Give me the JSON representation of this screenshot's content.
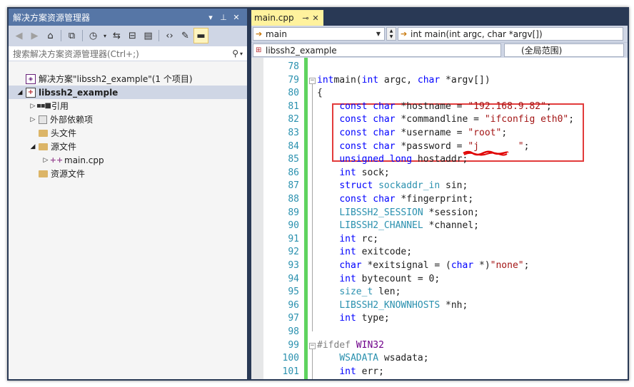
{
  "solution_explorer": {
    "title": "解决方案资源管理器",
    "title_buttons": [
      "▾",
      "⊥",
      "✕"
    ],
    "search_placeholder": "搜索解决方案资源管理器(Ctrl+;)",
    "tree": [
      {
        "label": "解决方案\"libssh2_example\"(1 个项目)",
        "level": 0,
        "icon": "solution-icon",
        "expand": ""
      },
      {
        "label": "libssh2_example",
        "level": 0,
        "icon": "cpp-project-icon",
        "expand": "◢",
        "selected": true
      },
      {
        "label": "引用",
        "level": 1,
        "icon": "references-icon",
        "expand": "▷"
      },
      {
        "label": "外部依赖项",
        "level": 1,
        "icon": "external-dependencies-icon",
        "expand": "▷"
      },
      {
        "label": "头文件",
        "level": 1,
        "icon": "folder-icon",
        "expand": ""
      },
      {
        "label": "源文件",
        "level": 1,
        "icon": "folder-open-icon",
        "expand": "◢"
      },
      {
        "label": "main.cpp",
        "level": 2,
        "icon": "cpp-file-icon",
        "expand": "▷"
      },
      {
        "label": "资源文件",
        "level": 1,
        "icon": "folder-icon",
        "expand": ""
      }
    ]
  },
  "editor": {
    "tab": {
      "label": "main.cpp"
    },
    "nav": {
      "scope": "main",
      "member": "int main(int argc, char *argv[])",
      "project": "libssh2_example",
      "range": "(全局范围)"
    },
    "first_line": 78,
    "line_numbers": [
      "78",
      "79",
      "80",
      "81",
      "82",
      "83",
      "84",
      "85",
      "86",
      "87",
      "88",
      "89",
      "90",
      "91",
      "92",
      "93",
      "94",
      "95",
      "96",
      "97",
      "98",
      "99",
      "100",
      "101"
    ],
    "lines": [
      [],
      [
        [
          "kw",
          "int"
        ],
        [
          "",
          "main("
        ],
        [
          "kw",
          "int"
        ],
        [
          "",
          " argc, "
        ],
        [
          "kw",
          "char"
        ],
        [
          "",
          " *argv[])"
        ]
      ],
      [
        [
          "",
          "{"
        ]
      ],
      [
        [
          "",
          "    "
        ],
        [
          "kw",
          "const"
        ],
        [
          "",
          " "
        ],
        [
          "kw",
          "char"
        ],
        [
          "",
          " *hostname = "
        ],
        [
          "st",
          "\"192.168.9.82\""
        ],
        [
          "",
          ";"
        ]
      ],
      [
        [
          "",
          "    "
        ],
        [
          "kw",
          "const"
        ],
        [
          "",
          " "
        ],
        [
          "kw",
          "char"
        ],
        [
          "",
          " *commandline = "
        ],
        [
          "st",
          "\"ifconfig eth0\""
        ],
        [
          "",
          ";"
        ]
      ],
      [
        [
          "",
          "    "
        ],
        [
          "kw",
          "const"
        ],
        [
          "",
          " "
        ],
        [
          "kw",
          "char"
        ],
        [
          "",
          " *username = "
        ],
        [
          "st",
          "\"root\""
        ],
        [
          "",
          ";"
        ]
      ],
      [
        [
          "",
          "    "
        ],
        [
          "kw",
          "const"
        ],
        [
          "",
          " "
        ],
        [
          "kw",
          "char"
        ],
        [
          "",
          " *password = "
        ],
        [
          "st",
          "\"j       \""
        ],
        [
          "",
          ";"
        ]
      ],
      [
        [
          "",
          "    "
        ],
        [
          "kw",
          "unsigned"
        ],
        [
          "",
          " "
        ],
        [
          "kw",
          "long"
        ],
        [
          "",
          " hostaddr;"
        ]
      ],
      [
        [
          "",
          "    "
        ],
        [
          "kw",
          "int"
        ],
        [
          "",
          " sock;"
        ]
      ],
      [
        [
          "",
          "    "
        ],
        [
          "kw",
          "struct"
        ],
        [
          "",
          " "
        ],
        [
          "ty",
          "sockaddr_in"
        ],
        [
          "",
          " sin;"
        ]
      ],
      [
        [
          "",
          "    "
        ],
        [
          "kw",
          "const"
        ],
        [
          "",
          " "
        ],
        [
          "kw",
          "char"
        ],
        [
          "",
          " *fingerprint;"
        ]
      ],
      [
        [
          "",
          "    "
        ],
        [
          "ty",
          "LIBSSH2_SESSION"
        ],
        [
          "",
          " *session;"
        ]
      ],
      [
        [
          "",
          "    "
        ],
        [
          "ty",
          "LIBSSH2_CHANNEL"
        ],
        [
          "",
          " *channel;"
        ]
      ],
      [
        [
          "",
          "    "
        ],
        [
          "kw",
          "int"
        ],
        [
          "",
          " rc;"
        ]
      ],
      [
        [
          "",
          "    "
        ],
        [
          "kw",
          "int"
        ],
        [
          "",
          " exitcode;"
        ]
      ],
      [
        [
          "",
          "    "
        ],
        [
          "kw",
          "char"
        ],
        [
          "",
          " *exitsignal = ("
        ],
        [
          "kw",
          "char"
        ],
        [
          "",
          " *)"
        ],
        [
          "st",
          "\"none\""
        ],
        [
          "",
          ";"
        ]
      ],
      [
        [
          "",
          "    "
        ],
        [
          "kw",
          "int"
        ],
        [
          "",
          " bytecount = 0;"
        ]
      ],
      [
        [
          "",
          "    "
        ],
        [
          "ty",
          "size_t"
        ],
        [
          "",
          " len;"
        ]
      ],
      [
        [
          "",
          "    "
        ],
        [
          "ty",
          "LIBSSH2_KNOWNHOSTS"
        ],
        [
          "",
          " *nh;"
        ]
      ],
      [
        [
          "",
          "    "
        ],
        [
          "kw",
          "int"
        ],
        [
          "",
          " type;"
        ]
      ],
      [],
      [
        [
          "pp",
          "#ifdef"
        ],
        [
          "",
          " "
        ],
        [
          "mac",
          "WIN32"
        ]
      ],
      [
        [
          "",
          "    "
        ],
        [
          "ty",
          "WSADATA"
        ],
        [
          "",
          " wsadata;"
        ]
      ],
      [
        [
          "",
          "    "
        ],
        [
          "kw",
          "int"
        ],
        [
          "",
          " err;"
        ]
      ]
    ]
  }
}
